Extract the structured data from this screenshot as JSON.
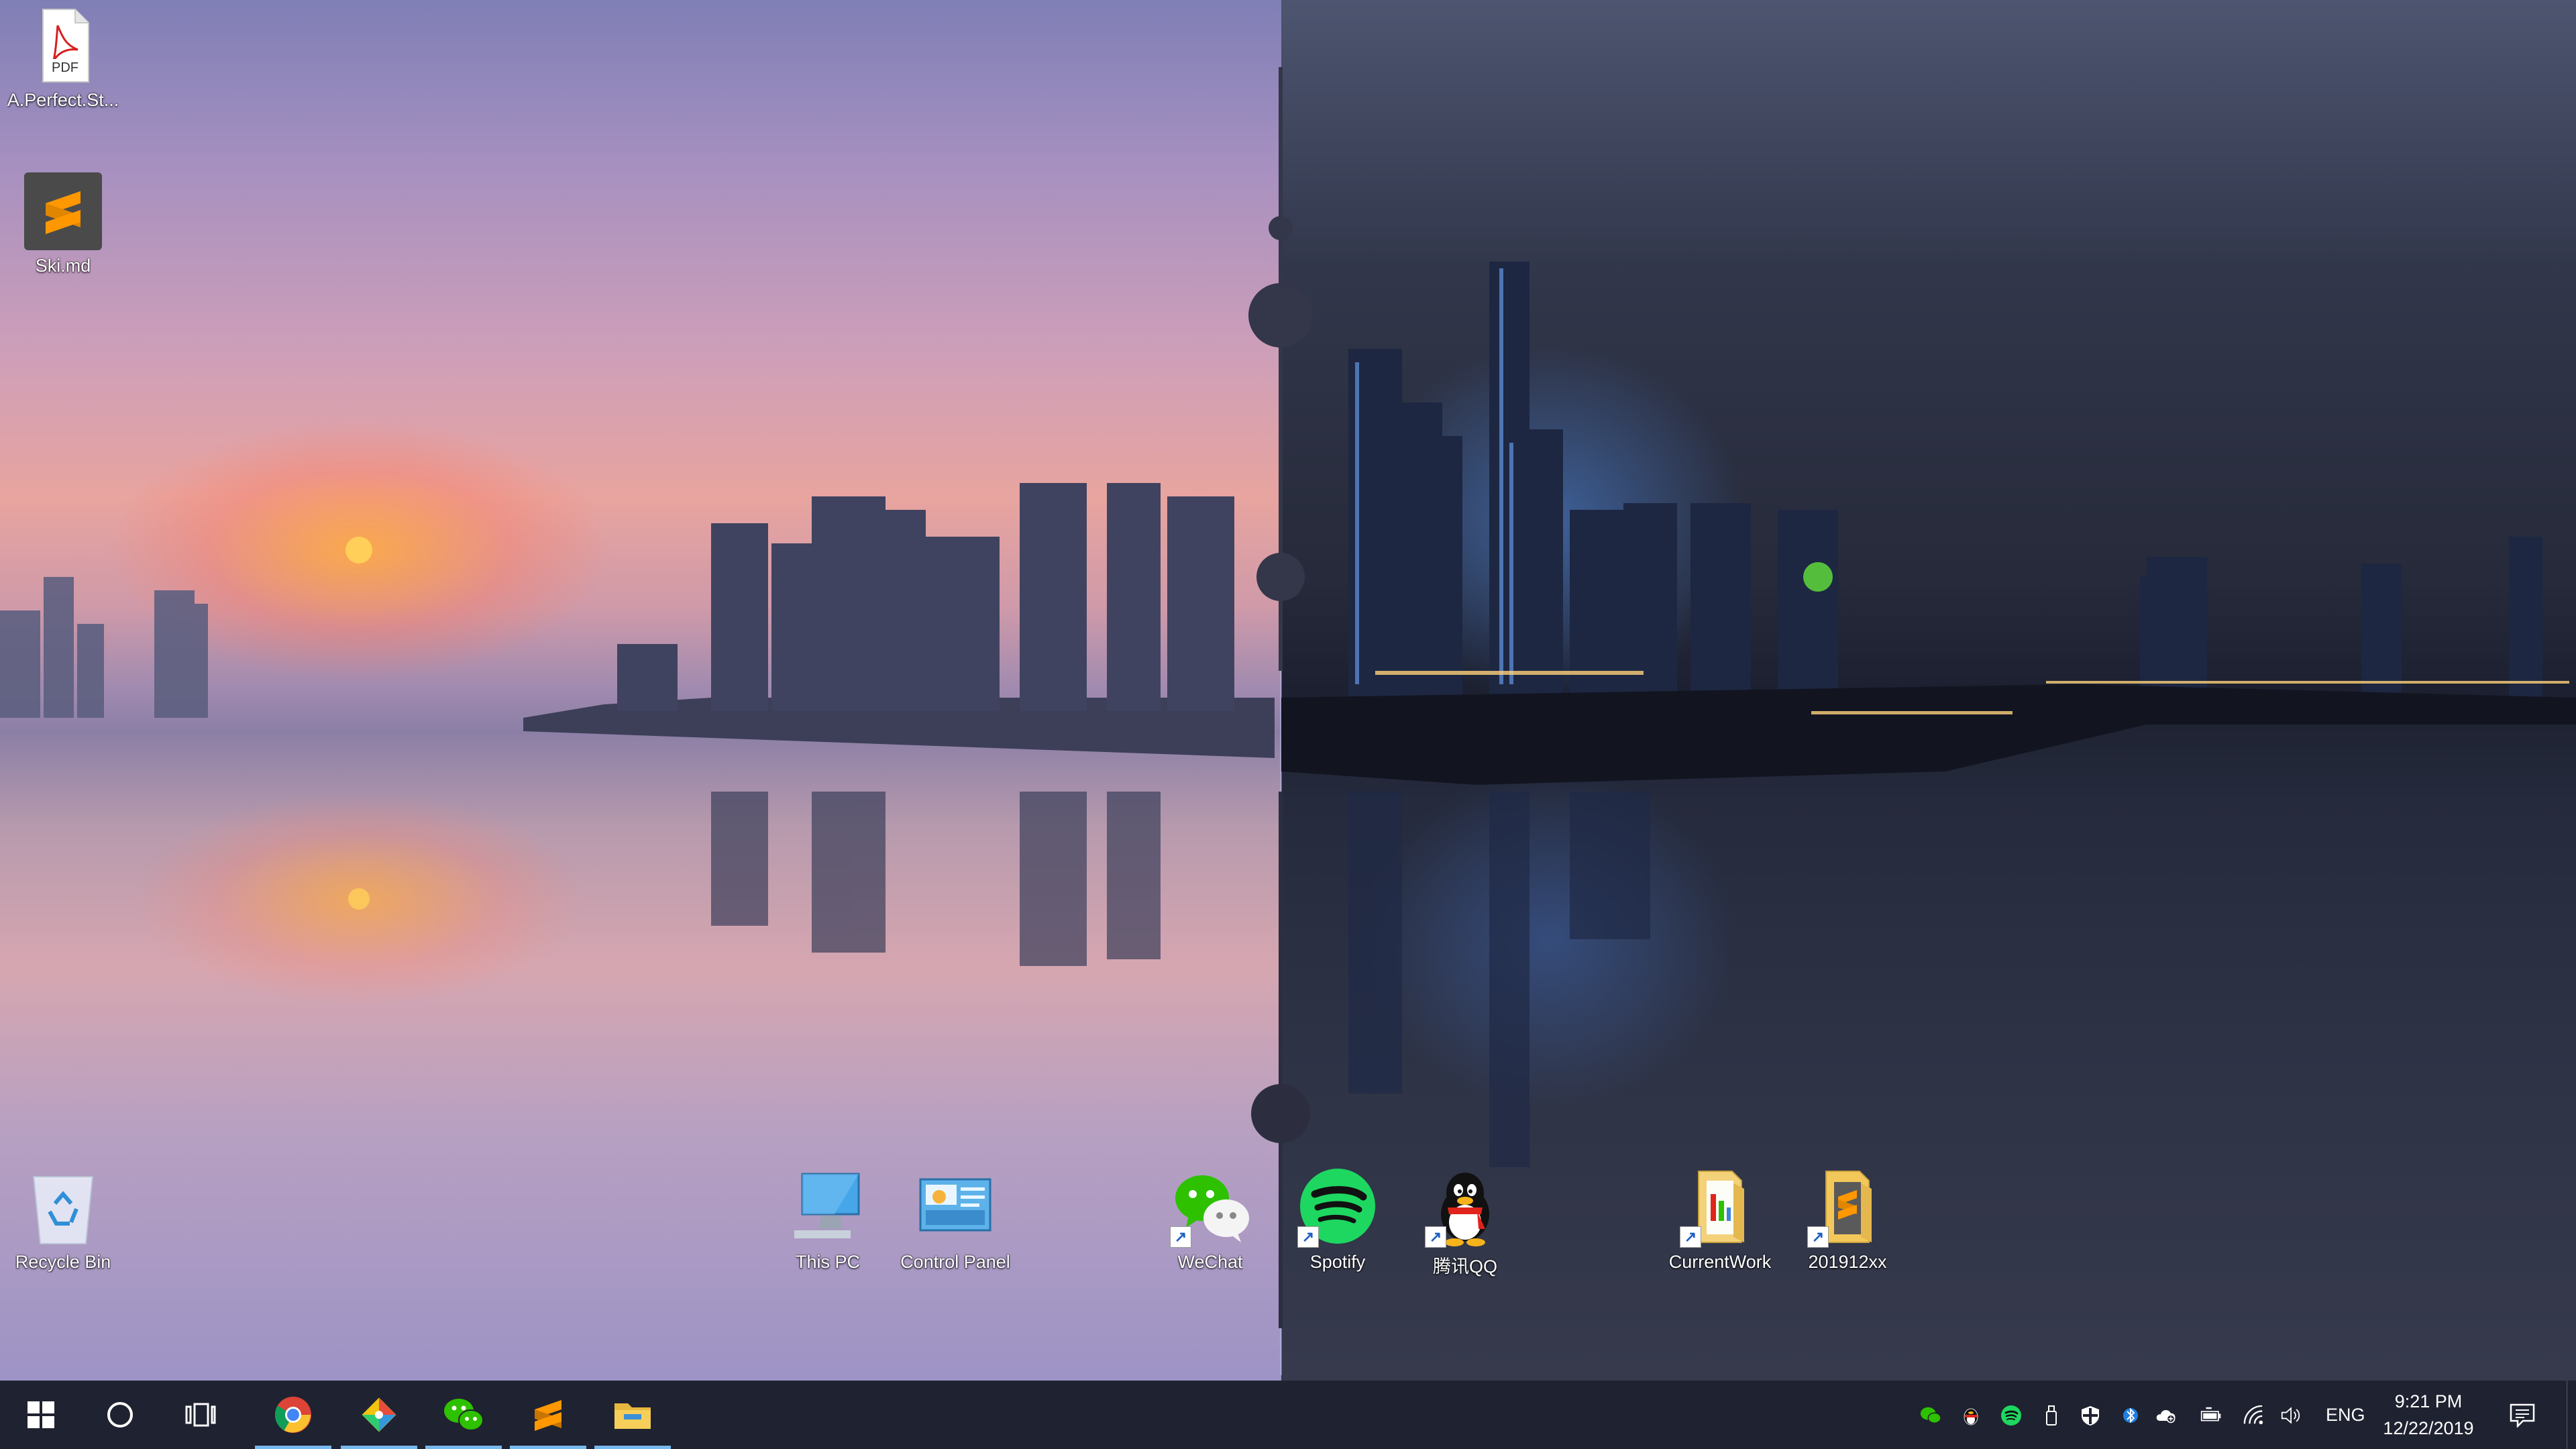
{
  "desktop": {
    "icons": [
      {
        "label": "A.Perfect.St...",
        "type": "pdf",
        "badge": "PDF"
      },
      {
        "label": "Ski.md",
        "type": "sublime"
      },
      {
        "label": "Recycle Bin",
        "type": "recycle-bin"
      },
      {
        "label": "This PC",
        "type": "this-pc"
      },
      {
        "label": "Control Panel",
        "type": "control-panel"
      },
      {
        "label": "WeChat",
        "type": "wechat",
        "shortcut": true
      },
      {
        "label": "Spotify",
        "type": "spotify",
        "shortcut": true
      },
      {
        "label": "腾讯QQ",
        "type": "qq",
        "shortcut": true
      },
      {
        "label": "CurrentWork",
        "type": "folder",
        "shortcut": true
      },
      {
        "label": "201912xx",
        "type": "folder",
        "shortcut": true
      }
    ]
  },
  "taskbar": {
    "pinned": [
      {
        "name": "start",
        "icon": "windows-logo-icon"
      },
      {
        "name": "search",
        "icon": "cortana-circle-icon"
      },
      {
        "name": "task-view",
        "icon": "task-view-icon"
      },
      {
        "name": "chrome",
        "icon": "chrome-icon",
        "active": true
      },
      {
        "name": "git",
        "icon": "git-icon",
        "active": true
      },
      {
        "name": "wechat",
        "icon": "wechat-icon",
        "active": true
      },
      {
        "name": "sublime",
        "icon": "sublime-icon",
        "active": true
      },
      {
        "name": "explorer",
        "icon": "file-explorer-icon",
        "active": true
      }
    ],
    "tray": {
      "icons": [
        "wechat-tray-icon",
        "qq-tray-icon",
        "spotify-tray-icon",
        "usb-icon",
        "security-shield-icon",
        "bluetooth-icon",
        "onedrive-icon",
        "battery-icon",
        "wifi-icon",
        "volume-icon"
      ],
      "language": "ENG",
      "time": "9:21 PM",
      "date": "12/22/2019"
    }
  },
  "colors": {
    "taskbar_bg": "#1f2230",
    "active_indicator": "#76b9ed",
    "spotify_green": "#1ed760",
    "wechat_green": "#2dc100",
    "sublime_orange": "#ff9800"
  }
}
